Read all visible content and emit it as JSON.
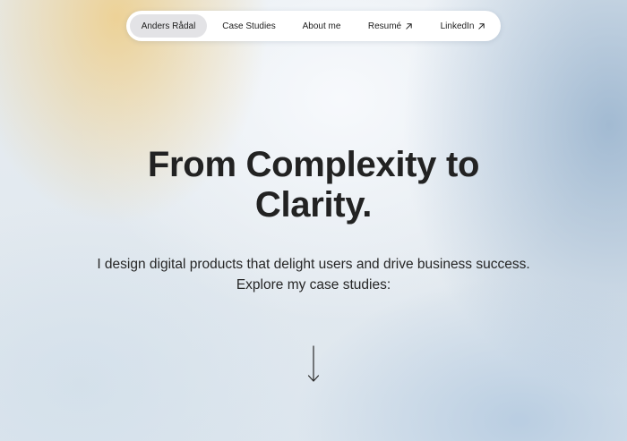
{
  "nav": {
    "items": [
      {
        "label": "Anders Rådal",
        "active": true
      },
      {
        "label": "Case Studies"
      },
      {
        "label": "About me"
      },
      {
        "label": "Resumé",
        "icon": "external-link-arrow-icon"
      },
      {
        "label": "LinkedIn",
        "icon": "external-link-arrow-icon"
      }
    ]
  },
  "hero": {
    "title_line1": "From Complexity to",
    "title_line2": "Clarity.",
    "subtitle_line1": "I design digital products that delight users and drive business success.",
    "subtitle_line2": "Explore my case studies:",
    "scroll_icon": "arrow-down-icon"
  },
  "colors": {
    "text": "#222222",
    "nav_background": "#ffffff",
    "nav_active_pill": "#e3e3e6",
    "background_warm_accent": "#eecd87",
    "background_cool_accent": "#8caac8"
  }
}
